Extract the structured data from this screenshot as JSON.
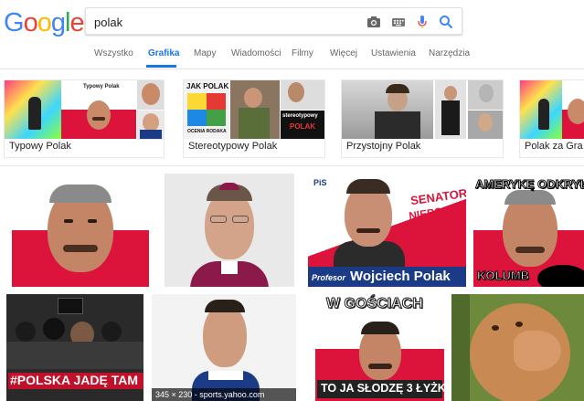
{
  "logo": {
    "letters": [
      "G",
      "o",
      "o",
      "g",
      "l",
      "e"
    ],
    "colors": [
      "#4285F4",
      "#EA4335",
      "#FBBC05",
      "#4285F4",
      "#34A853",
      "#EA4335"
    ]
  },
  "search": {
    "query": "polak",
    "icons": [
      "camera-icon",
      "keyboard-icon",
      "microphone-icon",
      "search-icon"
    ]
  },
  "tabs": [
    {
      "label": "Wszystko",
      "active": false
    },
    {
      "label": "Grafika",
      "active": true
    },
    {
      "label": "Mapy",
      "active": false
    },
    {
      "label": "Wiadomości",
      "active": false
    },
    {
      "label": "Filmy",
      "active": false
    },
    {
      "label": "Więcej",
      "active": false
    },
    {
      "label": "Ustawienia",
      "active": false
    },
    {
      "label": "Narzędzia",
      "active": false
    }
  ],
  "related": [
    {
      "label": "Typowy Polak",
      "thumb_text": [
        "Typowy Polak"
      ]
    },
    {
      "label": "Stereotypowy Polak",
      "thumb_text": [
        "JAK POLAK",
        "OCENIA RODAKA",
        "stereotypowy",
        "POLAK"
      ]
    },
    {
      "label": "Przystojny Polak"
    },
    {
      "label": "Polak za Gra"
    }
  ],
  "results": [
    {
      "id": "flag-face-1"
    },
    {
      "id": "bishop"
    },
    {
      "id": "senator",
      "texts": [
        "PiS",
        "SENATOR",
        "NIEPOKORNY",
        "Profesor",
        "Wojciech Polak"
      ]
    },
    {
      "id": "columbus",
      "texts": [
        "AMERYKĘ ODKRYŁ",
        "KOLUMB"
      ]
    },
    {
      "id": "polska-jade",
      "texts": [
        "#POLSKA JADĘ TAM"
      ]
    },
    {
      "id": "sports",
      "caption": "345 × 230 - sports.yahoo.com"
    },
    {
      "id": "gosciach",
      "texts": [
        "W GOŚCIACH",
        "TO JA SŁODZĘ 3 ŁYŻKI"
      ]
    },
    {
      "id": "monkey"
    }
  ],
  "colors": {
    "accent": "#1a73e8",
    "flag_red": "#dc143c",
    "flag_white": "#ffffff",
    "senator_blue": "#1b3b87"
  }
}
